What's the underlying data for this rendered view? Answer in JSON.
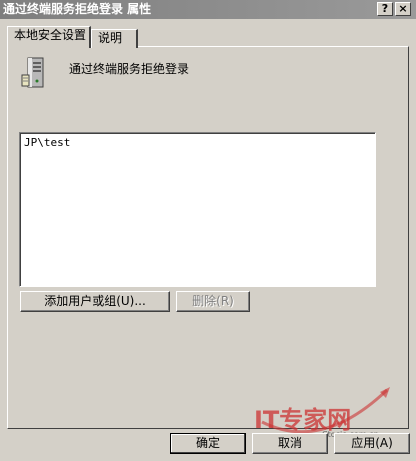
{
  "window": {
    "title": "通过终端服务拒绝登录 属性",
    "help_glyph": "?",
    "close_glyph": "×"
  },
  "tabs": [
    {
      "label": "本地安全设置"
    },
    {
      "label": "说明"
    }
  ],
  "policy": {
    "name": "通过终端服务拒绝登录",
    "icon": "server-icon"
  },
  "accounts": [
    "JP\\test"
  ],
  "buttons": {
    "add": "添加用户或组(U)...",
    "remove": "删除(R)",
    "ok": "确定",
    "cancel": "取消",
    "apply": "应用(A)"
  },
  "watermark": {
    "brand": "IT专家网",
    "domain": "Ctocio.com.cn"
  },
  "colors": {
    "face": "#d4d0c8",
    "titlebar": "#808080",
    "watermark": "#cc3333"
  }
}
